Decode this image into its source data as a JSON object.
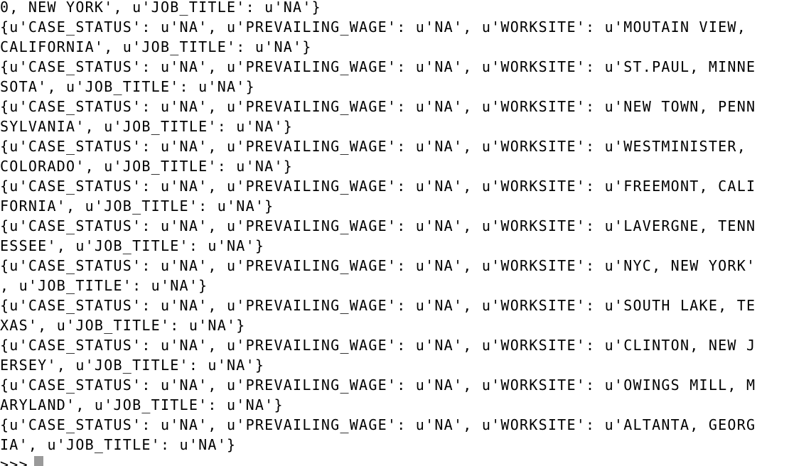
{
  "terminal": {
    "lines": [
      "0, NEW YORK', u'JOB_TITLE': u'NA'}",
      "{u'CASE_STATUS': u'NA', u'PREVAILING_WAGE': u'NA', u'WORKSITE': u'MOUTAIN VIEW, ",
      "CALIFORNIA', u'JOB_TITLE': u'NA'}",
      "{u'CASE_STATUS': u'NA', u'PREVAILING_WAGE': u'NA', u'WORKSITE': u'ST.PAUL, MINNE",
      "SOTA', u'JOB_TITLE': u'NA'}",
      "{u'CASE_STATUS': u'NA', u'PREVAILING_WAGE': u'NA', u'WORKSITE': u'NEW TOWN, PENN",
      "SYLVANIA', u'JOB_TITLE': u'NA'}",
      "{u'CASE_STATUS': u'NA', u'PREVAILING_WAGE': u'NA', u'WORKSITE': u'WESTMINISTER, ",
      "COLORADO', u'JOB_TITLE': u'NA'}",
      "{u'CASE_STATUS': u'NA', u'PREVAILING_WAGE': u'NA', u'WORKSITE': u'FREEMONT, CALI",
      "FORNIA', u'JOB_TITLE': u'NA'}",
      "{u'CASE_STATUS': u'NA', u'PREVAILING_WAGE': u'NA', u'WORKSITE': u'LAVERGNE, TENN",
      "ESSEE', u'JOB_TITLE': u'NA'}",
      "{u'CASE_STATUS': u'NA', u'PREVAILING_WAGE': u'NA', u'WORKSITE': u'NYC, NEW YORK'",
      ", u'JOB_TITLE': u'NA'}",
      "{u'CASE_STATUS': u'NA', u'PREVAILING_WAGE': u'NA', u'WORKSITE': u'SOUTH LAKE, TE",
      "XAS', u'JOB_TITLE': u'NA'}",
      "{u'CASE_STATUS': u'NA', u'PREVAILING_WAGE': u'NA', u'WORKSITE': u'CLINTON, NEW J",
      "ERSEY', u'JOB_TITLE': u'NA'}",
      "{u'CASE_STATUS': u'NA', u'PREVAILING_WAGE': u'NA', u'WORKSITE': u'OWINGS MILL, M",
      "ARYLAND', u'JOB_TITLE': u'NA'}",
      "{u'CASE_STATUS': u'NA', u'PREVAILING_WAGE': u'NA', u'WORKSITE': u'ALTANTA, GEORG",
      "IA', u'JOB_TITLE': u'NA'}"
    ],
    "prompt": ">>>",
    "cursor_color": "#9a9a9a",
    "background_color": "#ffffff",
    "text_color": "#000000"
  }
}
